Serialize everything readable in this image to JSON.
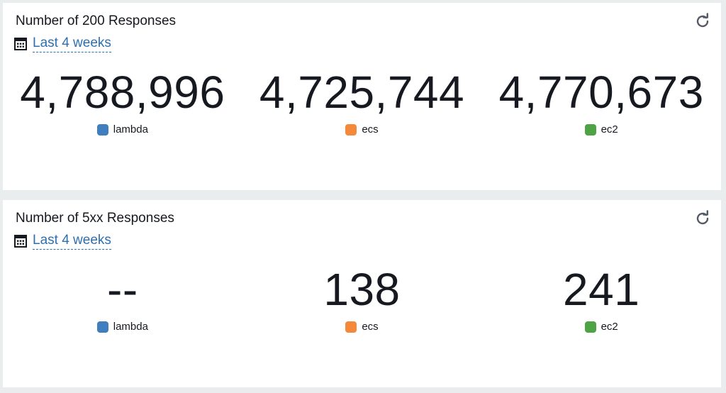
{
  "widgets": [
    {
      "title": "Number of 200 Responses",
      "time_range": "Last 4 weeks",
      "metrics": [
        {
          "value": "4,788,996",
          "label": "lambda",
          "color": "#3f7fc0"
        },
        {
          "value": "4,725,744",
          "label": "ecs",
          "color": "#f5893a"
        },
        {
          "value": "4,770,673",
          "label": "ec2",
          "color": "#4ea444"
        }
      ]
    },
    {
      "title": "Number of 5xx Responses",
      "time_range": "Last 4 weeks",
      "metrics": [
        {
          "value": "--",
          "label": "lambda",
          "color": "#3f7fc0"
        },
        {
          "value": "138",
          "label": "ecs",
          "color": "#f5893a"
        },
        {
          "value": "241",
          "label": "ec2",
          "color": "#4ea444"
        }
      ]
    }
  ],
  "icons": {
    "refresh": "refresh-icon",
    "calendar": "calendar-icon"
  }
}
